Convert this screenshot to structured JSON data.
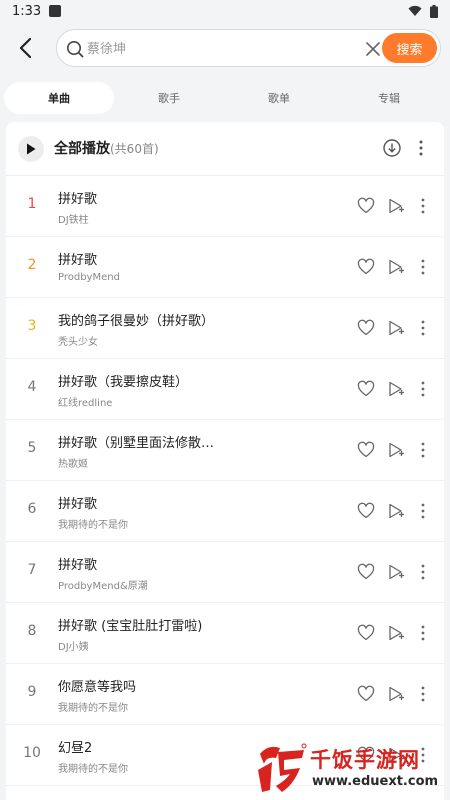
{
  "status_bar": {
    "time": "1:33"
  },
  "search": {
    "placeholder": "蔡徐坤",
    "value": "",
    "button_label": "搜索"
  },
  "tabs": [
    {
      "label": "单曲",
      "active": true
    },
    {
      "label": "歌手",
      "active": false
    },
    {
      "label": "歌单",
      "active": false
    },
    {
      "label": "专辑",
      "active": false
    }
  ],
  "play_all": {
    "label": "全部播放",
    "count": "(共60首)"
  },
  "songs": [
    {
      "rank": "1",
      "title": "拼好歌",
      "artist": "DJ铁柱"
    },
    {
      "rank": "2",
      "title": "拼好歌",
      "artist": "ProdbyMend"
    },
    {
      "rank": "3",
      "title": "我的鸽子很曼妙（拼好歌）",
      "artist": "秃头少女"
    },
    {
      "rank": "4",
      "title": "拼好歌（我要擦皮鞋）",
      "artist": "红线redline"
    },
    {
      "rank": "5",
      "title": "拼好歌（别墅里面法修散…",
      "artist": "热歌姬"
    },
    {
      "rank": "6",
      "title": "拼好歌",
      "artist": "我期待的不是你"
    },
    {
      "rank": "7",
      "title": "拼好歌",
      "artist": "ProdbyMend&原潮"
    },
    {
      "rank": "8",
      "title": "拼好歌 (宝宝肚肚打雷啦)",
      "artist": "DJ小姨"
    },
    {
      "rank": "9",
      "title": "你愿意等我吗",
      "artist": "我期待的不是你"
    },
    {
      "rank": "10",
      "title": "幻昼2",
      "artist": "我期待的不是你"
    }
  ],
  "watermark": {
    "name": "千饭手游网",
    "url": "www.eduext.com"
  },
  "colors": {
    "accent": "#ff7a2a",
    "rank1": "#e84a4a",
    "rank2": "#f0912b",
    "rank3": "#e8b320"
  },
  "icons": [
    "back-icon",
    "search-icon",
    "clear-icon",
    "play-icon",
    "download-icon",
    "more-icon",
    "heart-icon",
    "play-next-icon"
  ]
}
